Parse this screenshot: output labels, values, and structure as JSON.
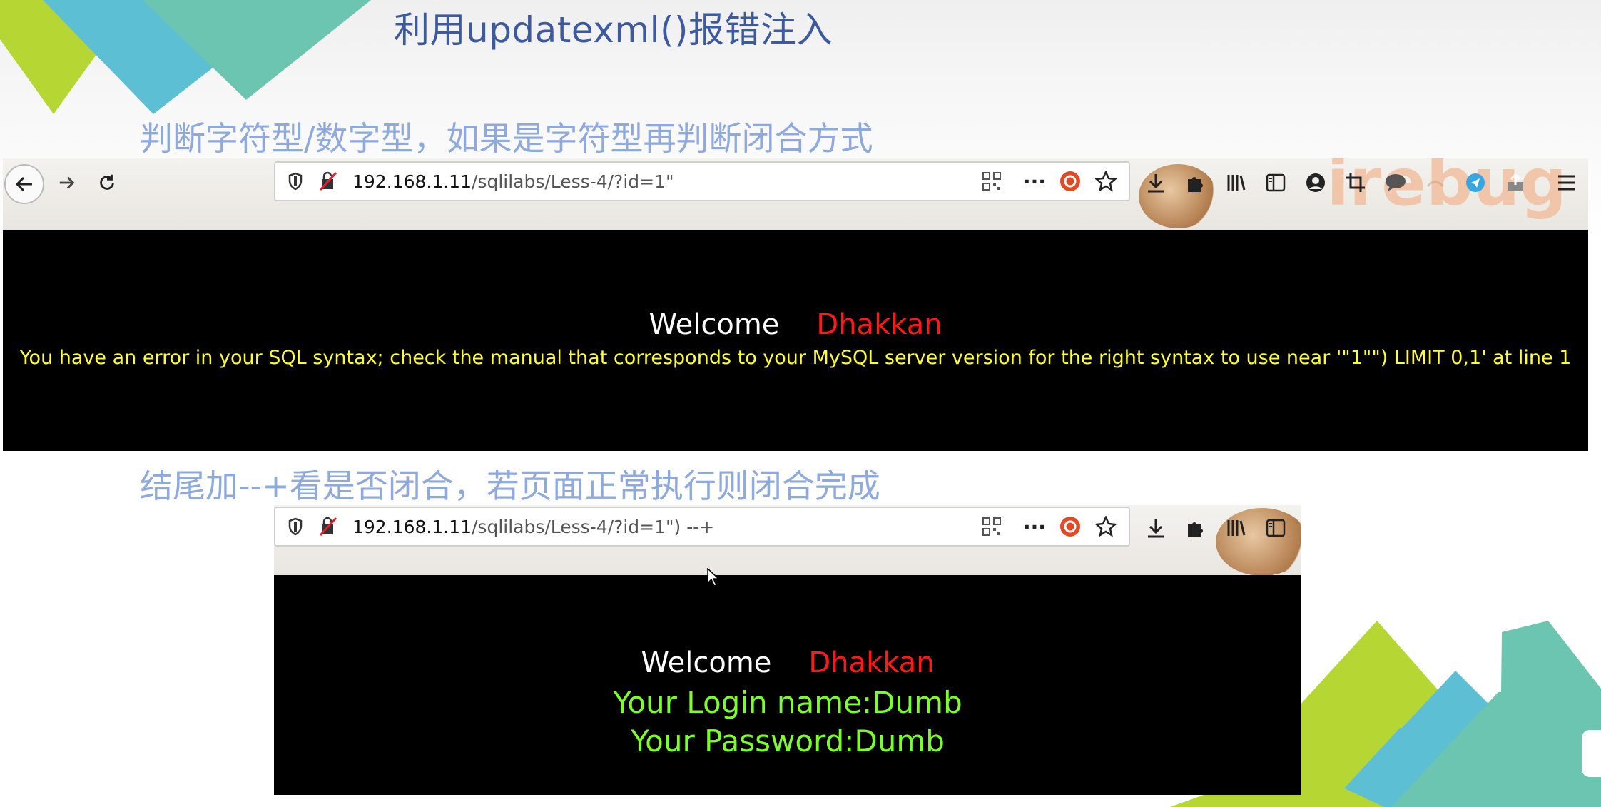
{
  "slide": {
    "title": "利用updatexml()报错注入",
    "caption1": "判断字符型/数字型，如果是字符型再判断闭合方式",
    "caption2": "结尾加--+看是否闭合，若页面正常执行则闭合完成"
  },
  "browser1": {
    "url_host": "192.168.1.11",
    "url_path": "/sqlilabs/Less-4/?id=1\"",
    "welcome": "Welcome",
    "name": "Dhakkan",
    "error": "You have an error in your SQL syntax; check the manual that corresponds to your MySQL server version for the right syntax to use near '\"1\"\") LIMIT 0,1' at line 1"
  },
  "browser2": {
    "url_host": "192.168.1.11",
    "url_path": "/sqlilabs/Less-4/?id=1\") --+",
    "welcome": "Welcome",
    "name": "Dhakkan",
    "login": "Your Login name:Dumb",
    "password": "Your Password:Dumb"
  },
  "icons": [
    "back-icon",
    "forward-icon",
    "reload-icon",
    "shield-icon",
    "insecure-icon",
    "qr-icon",
    "more-icon",
    "ubuntu-icon",
    "star-icon",
    "download-icon",
    "puzzle-icon",
    "library-icon",
    "sidebar-icon",
    "profile-icon",
    "crop-icon",
    "chat-icon",
    "menu-icon"
  ],
  "colors": {
    "title": "#3d5a9e",
    "caption": "#8ea9dc",
    "welcome": "#ffffff",
    "name": "#ff1a1a",
    "error": "#ffff33",
    "success": "#7dff2a"
  }
}
